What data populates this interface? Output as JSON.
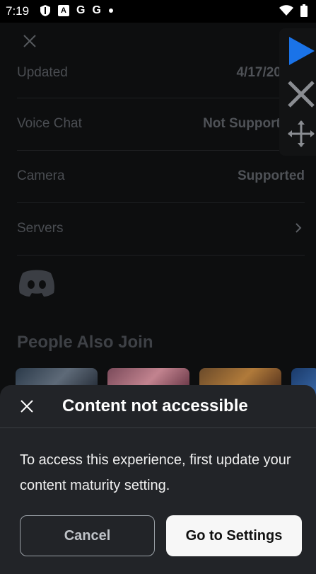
{
  "status_bar": {
    "time": "7:19",
    "icons": [
      "shield-icon",
      "a-icon",
      "google-icon",
      "google-icon",
      "dot-icon",
      "wifi-icon",
      "battery-icon"
    ],
    "google_letter": "G",
    "a_letter": "A"
  },
  "details": {
    "rows": [
      {
        "label": "Updated",
        "value": "4/17/2020"
      },
      {
        "label": "Voice Chat",
        "value": "Not Supported"
      },
      {
        "label": "Camera",
        "value": "Supported"
      },
      {
        "label": "Servers",
        "value": ""
      }
    ]
  },
  "people_also_join": {
    "title": "People Also Join"
  },
  "dialog": {
    "title": "Content not accessible",
    "message": "To access this experience, first update your content maturity setting.",
    "cancel_label": "Cancel",
    "settings_label": "Go to Settings"
  },
  "colors": {
    "accent_blue": "#1a73e8",
    "sheet_bg": "#222428",
    "primary_button_bg": "#f7f7f7"
  }
}
